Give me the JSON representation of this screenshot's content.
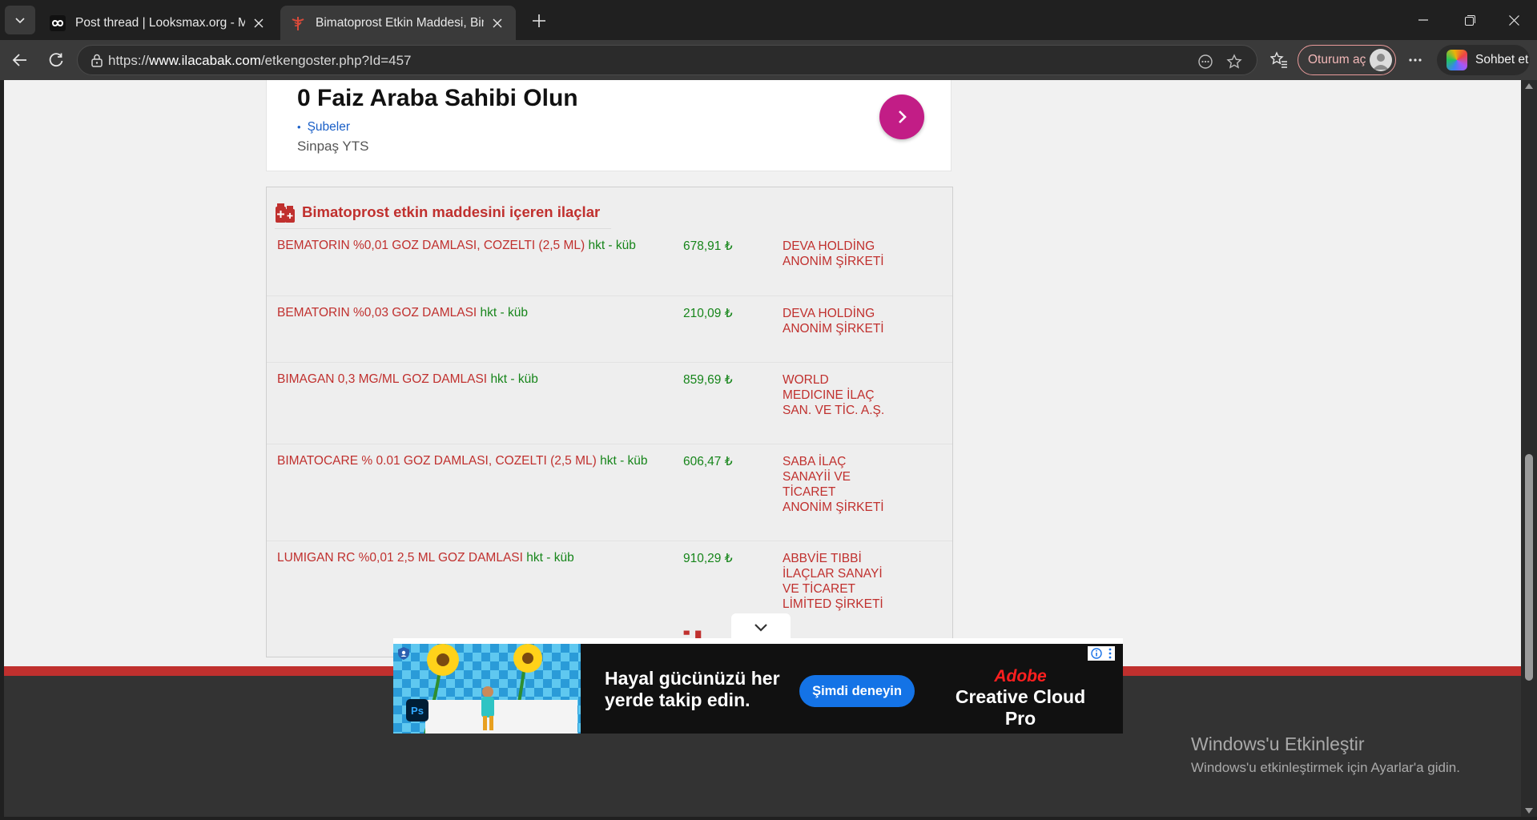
{
  "browser": {
    "tabs": [
      {
        "title": "Post thread | Looksmax.org - Men's",
        "active": false
      },
      {
        "title": "Bimatoprost Etkin Maddesi, Bimatoprost",
        "active": true
      }
    ],
    "url_prefix": "https://",
    "url_host": "www.ilacabak.com",
    "url_path": "/etkengoster.php?Id=457",
    "signin_label": "Oturum aç",
    "copilot_label": "Sohbet et"
  },
  "top_ad": {
    "headline": "0 Faiz Araba Sahibi Olun",
    "sitelink": "Şubeler",
    "advertiser": "Sinpaş YTS"
  },
  "drug_panel": {
    "title": "Bimatoprost etkin maddesini içeren ilaçlar",
    "rows": [
      {
        "name": "BEMATORIN %0,01 GOZ DAMLASI, COZELTI (2,5 ML)",
        "tag": "hkt - küb",
        "price": "678,91 ₺",
        "company": "DEVA HOLDİNG ANONİM ŞİRKETİ"
      },
      {
        "name": "BEMATORIN %0,03 GOZ DAMLASI",
        "tag": "hkt - küb",
        "price": "210,09 ₺",
        "company": "DEVA HOLDİNG ANONİM ŞİRKETİ"
      },
      {
        "name": "BIMAGAN 0,3 MG/ML GOZ DAMLASI",
        "tag": "hkt - küb",
        "price": "859,69 ₺",
        "company": "WORLD MEDICINE İLAÇ SAN. VE TİC. A.Ş."
      },
      {
        "name": "BIMATOCARE % 0.01 GOZ DAMLASI, COZELTI (2,5 ML)",
        "tag": "hkt - küb",
        "price": "606,47 ₺",
        "company": "SABA İLAÇ SANAYİİ VE TİCARET ANONİM ŞİRKETİ"
      },
      {
        "name": "LUMIGAN RC %0,01 2,5 ML GOZ DAMLASI",
        "tag": "hkt - küb",
        "price": "910,29 ₺",
        "company": "ABBVİE TIBBİ İLAÇLAR SANAYİ VE TİCARET LİMİTED ŞİRKETİ"
      }
    ]
  },
  "footer": {
    "logo_fragment": "ila"
  },
  "banner_ad": {
    "tagline_line1": "Hayal gücünüzü her",
    "tagline_line2": "yerde takip edin.",
    "cta": "Şimdi deneyin",
    "brand_line1": "Adobe",
    "brand_line2": "Creative Cloud Pro",
    "app_badge": "Ps"
  },
  "windows_watermark": {
    "title": "Windows'u Etkinleştir",
    "subtitle": "Windows'u etkinleştirmek için Ayarlar'a gidin."
  },
  "colors": {
    "accent_red": "#c0302e",
    "price_green": "#16851a",
    "ad_button_magenta": "#c21d86",
    "adobe_cta_blue": "#1473e6"
  }
}
